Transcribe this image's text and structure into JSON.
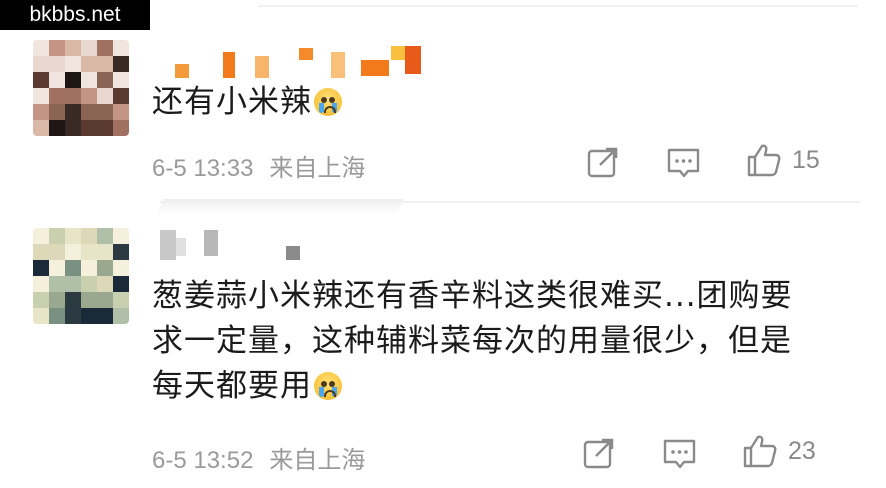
{
  "watermark": "bkbbs.net",
  "comments": [
    {
      "username": "",
      "text": "还有小米辣",
      "emoji": "crying-face-emoji",
      "time": "6-5 13:33",
      "location": "来自上海",
      "likes": "15"
    },
    {
      "username": "",
      "lines": [
        "葱姜蒜小米辣还有香辛料这类很难买...团购要",
        "求一定量，这种辅料菜每次的用量很少，但是",
        "每天都要用"
      ],
      "emoji": "crying-face-emoji",
      "time": "6-5 13:52",
      "location": "来自上海",
      "likes": "23"
    }
  ],
  "icons": {
    "share": "share-icon",
    "comment": "comment-icon",
    "like": "thumbs-up-icon"
  },
  "colors": {
    "text": "#1b1b1b",
    "meta": "#9a9a9a",
    "icon": "#8a8a8a"
  }
}
